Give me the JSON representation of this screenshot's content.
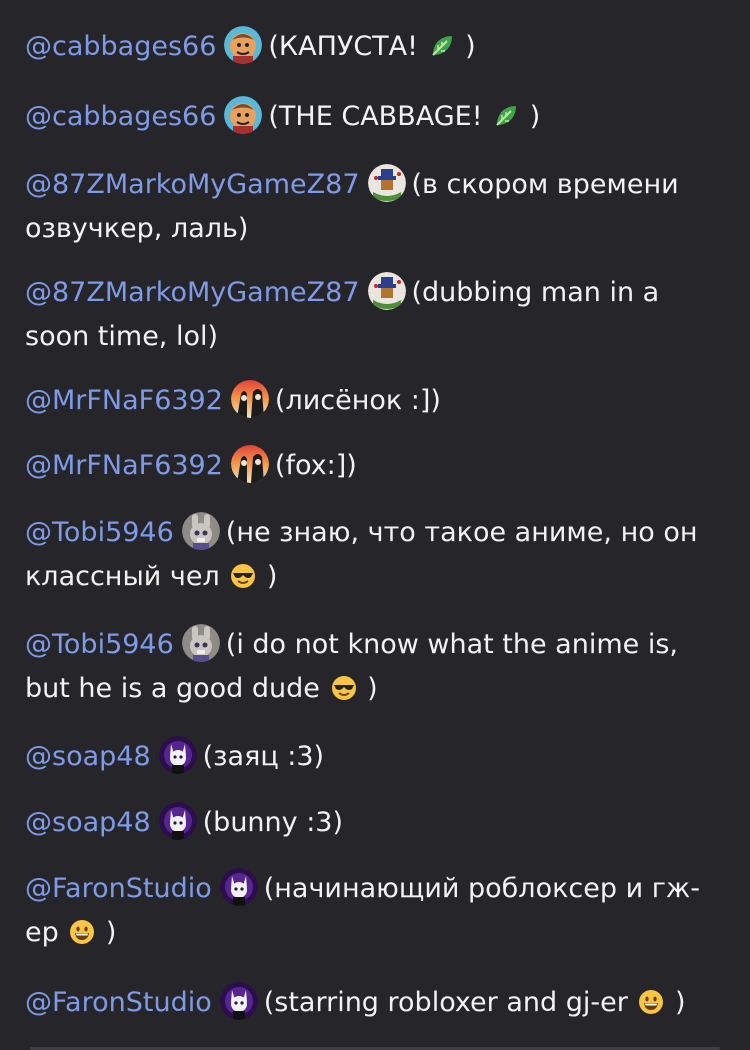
{
  "entries": [
    {
      "mention": "@cabbages66",
      "avatar": "cabbage-avatar-icon",
      "open": "(КАПУСТА! ",
      "emoji": "leafy-green-icon",
      "close": " )"
    },
    {
      "mention": "@cabbages66",
      "avatar": "cabbage-avatar-icon",
      "open": "(THE CABBAGE! ",
      "emoji": "leafy-green-icon",
      "close": " )"
    },
    {
      "mention": "@87ZMarkoMyGameZ87",
      "avatar": "marko-avatar-icon",
      "open": "(в скором времени озвучкер, лаль)",
      "emoji": "",
      "close": ""
    },
    {
      "mention": "@87ZMarkoMyGameZ87",
      "avatar": "marko-avatar-icon",
      "open": "(dubbing man in a soon time, lol)",
      "emoji": "",
      "close": ""
    },
    {
      "mention": "@MrFNaF6392",
      "avatar": "mrfnaf-avatar-icon",
      "open": "(лисёнок :])",
      "emoji": "",
      "close": ""
    },
    {
      "mention": "@MrFNaF6392",
      "avatar": "mrfnaf-avatar-icon",
      "open": "(fox:])",
      "emoji": "",
      "close": ""
    },
    {
      "mention": "@Tobi5946",
      "avatar": "tobi-avatar-icon",
      "open": "(не знаю, что такое аниме, но он классный чел ",
      "emoji": "sunglasses-face-icon",
      "close": " )"
    },
    {
      "mention": "@Tobi5946",
      "avatar": "tobi-avatar-icon",
      "open": "(i do not know what the anime is, but he is a good dude ",
      "emoji": "sunglasses-face-icon",
      "close": " )"
    },
    {
      "mention": "@soap48",
      "avatar": "soap-avatar-icon",
      "open": "(заяц :3)",
      "emoji": "",
      "close": ""
    },
    {
      "mention": "@soap48",
      "avatar": "soap-avatar-icon",
      "open": "(bunny :3)",
      "emoji": "",
      "close": ""
    },
    {
      "mention": "@FaronStudio",
      "avatar": "faron-avatar-icon",
      "open": "(начинающий роблоксер и гж-ер ",
      "emoji": "grinning-face-icon",
      "close": " )"
    },
    {
      "mention": "@FaronStudio",
      "avatar": "faron-avatar-icon",
      "open": "(starring robloxer and gj-er ",
      "emoji": "grinning-face-icon",
      "close": " )"
    }
  ],
  "colors": {
    "background": "#26262a",
    "mention": "#7f9ae6",
    "text": "#f2f2f2"
  }
}
